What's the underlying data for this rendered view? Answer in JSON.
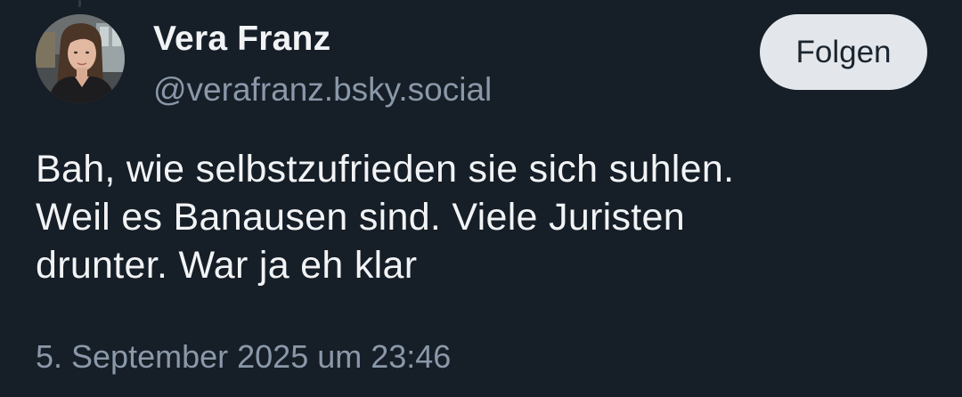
{
  "author": {
    "display_name": "Vera Franz",
    "handle": "@verafranz.bsky.social",
    "avatar_icon": "profile-photo"
  },
  "follow_button": {
    "label": "Folgen"
  },
  "post": {
    "lines": [
      "Bah, wie selbstzufrieden sie sich suhlen.",
      "Weil es Banausen sind. Viele Juristen",
      "drunter. War ja eh klar"
    ],
    "timestamp": "5. September 2025 um 23:46"
  },
  "colors": {
    "background": "#161e27",
    "text_primary": "#f1f3f5",
    "text_secondary": "#8a98a9",
    "button_bg": "#e3e7ec",
    "button_text": "#1b242e"
  }
}
